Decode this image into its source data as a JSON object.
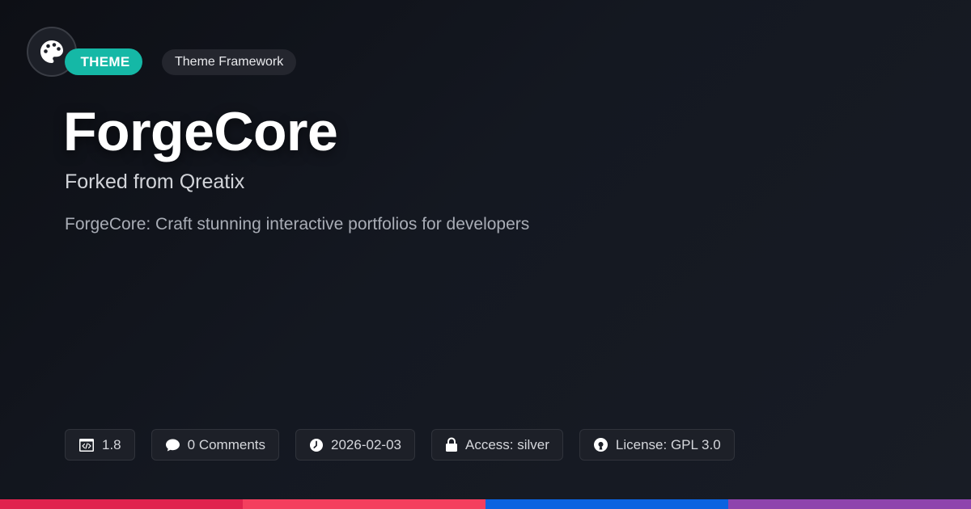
{
  "header": {
    "logo_icon": "palette-icon",
    "category_badge": "THEME",
    "type_badge": "Theme Framework"
  },
  "main": {
    "title": "ForgeCore",
    "subtitle": "Forked from Qreatix",
    "description": "ForgeCore: Craft stunning interactive portfolios for developers"
  },
  "meta": [
    {
      "icon": "code-window-icon",
      "label": "1.8"
    },
    {
      "icon": "chat-bubble-icon",
      "label": "0 Comments"
    },
    {
      "icon": "clock-icon",
      "label": "2026-02-03"
    },
    {
      "icon": "lock-icon",
      "label": "Access: silver"
    },
    {
      "icon": "open-source-icon",
      "label": "License: GPL 3.0"
    }
  ],
  "colors": {
    "accent": "#15b8a6",
    "bar": [
      "#e0234e",
      "#f43f5e",
      "#0b63e0",
      "#8e44ad"
    ]
  }
}
